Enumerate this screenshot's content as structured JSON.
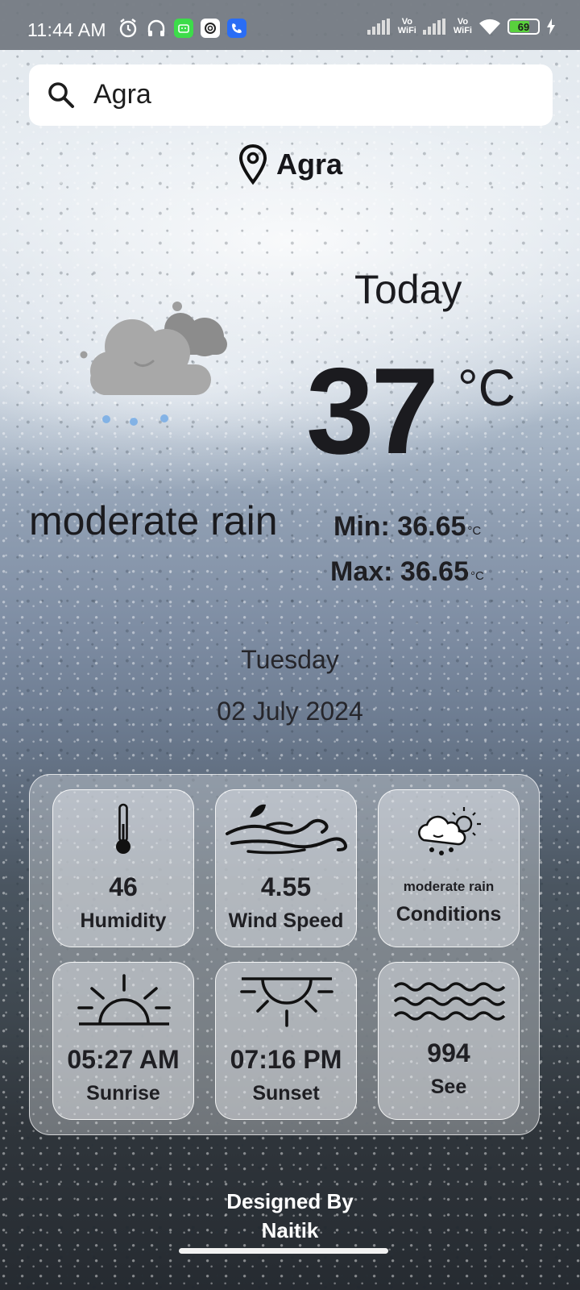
{
  "status_bar": {
    "time": "11:44 AM",
    "vowifi_1": "Vo\nWiFi",
    "vowifi_2": "Vo\nWiFi",
    "battery": "69",
    "battery_color": "#59d13d"
  },
  "search": {
    "value": "Agra",
    "icon": "search-icon"
  },
  "location": {
    "name": "Agra",
    "icon": "location-pin-icon"
  },
  "weather": {
    "heading": "Today",
    "temperature": "37",
    "unit": "°C",
    "condition": "moderate rain",
    "condition_icon": "rain-cloud-icon",
    "min_label": "Min: 36.65",
    "max_label": "Max: 36.65",
    "min_unit": "°C",
    "max_unit": "°C",
    "day": "Tuesday",
    "date": "02 July 2024"
  },
  "cards": [
    {
      "icon": "thermometer-icon",
      "value": "46",
      "label": "Humidity"
    },
    {
      "icon": "wind-icon",
      "value": "4.55",
      "label": "Wind Speed"
    },
    {
      "icon": "rain-sun-cloud-icon",
      "value": "moderate rain",
      "label": "Conditions"
    },
    {
      "icon": "sunrise-icon",
      "value": "05:27 AM",
      "label": "Sunrise"
    },
    {
      "icon": "sunset-icon",
      "value": "07:16 PM",
      "label": "Sunset"
    },
    {
      "icon": "sea-waves-icon",
      "value": "994",
      "label": "See"
    }
  ],
  "footer": {
    "line1": "Designed By",
    "line2": "Naitik"
  }
}
